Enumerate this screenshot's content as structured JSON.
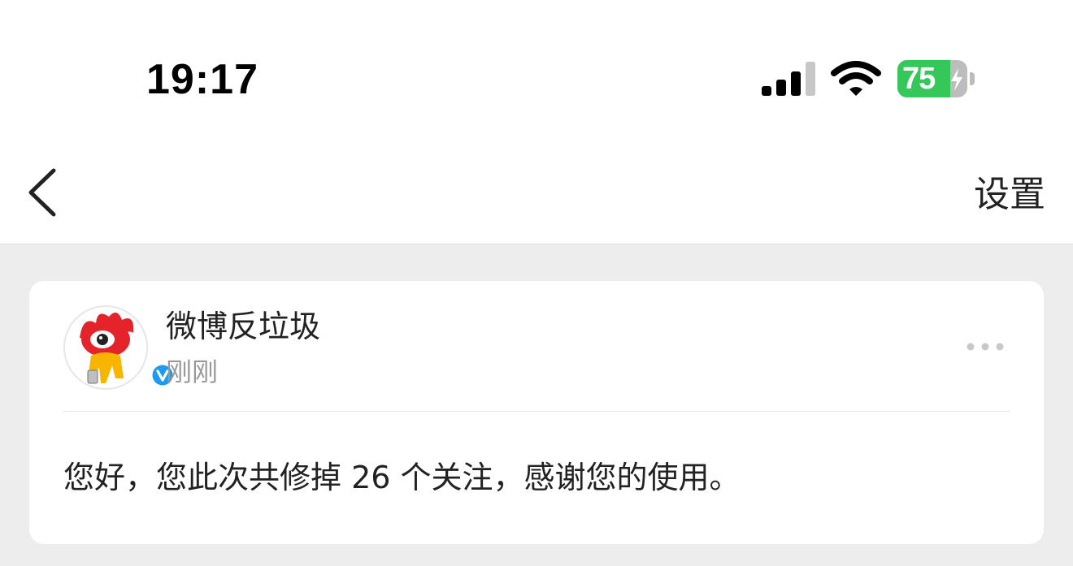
{
  "status_bar": {
    "time": "19:17",
    "battery_percent": "75",
    "battery_level": 0.75,
    "signal_icon": "cellular-signal-icon",
    "wifi_icon": "wifi-icon",
    "battery_icon": "battery-charging-icon",
    "battery_color": "#35c759"
  },
  "nav": {
    "back_icon": "chevron-left-icon",
    "settings_label": "设置"
  },
  "message": {
    "sender": "微博反垃圾",
    "time": "刚刚",
    "avatar_icon": "weibo-logo-avatar",
    "verified_icon": "verified-badge-icon",
    "verified_color": "#1d9bf0",
    "more_icon": "more-dots-icon",
    "text": "您好，您此次共修掉 26 个关注，感谢您的使用。"
  }
}
